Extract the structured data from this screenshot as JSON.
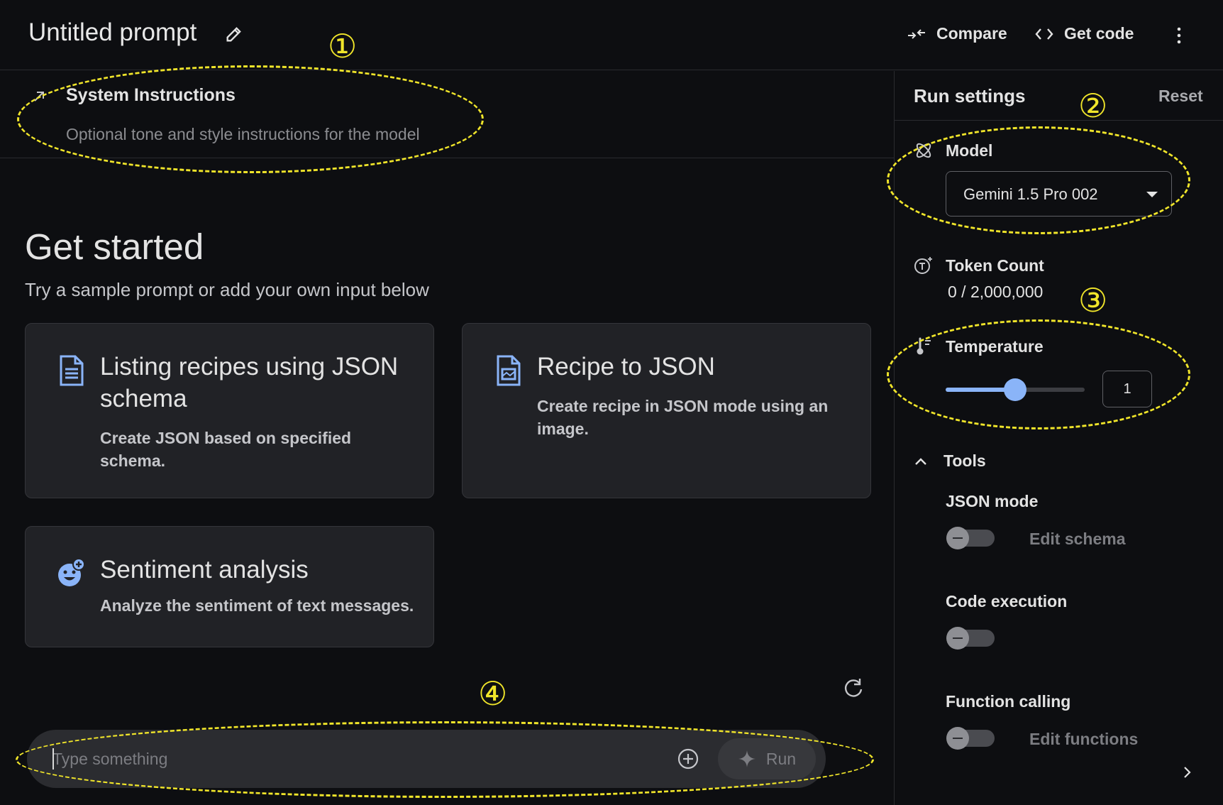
{
  "header": {
    "title": "Untitled prompt",
    "compare_label": "Compare",
    "get_code_label": "Get code"
  },
  "system_instructions": {
    "title": "System Instructions",
    "placeholder": "Optional tone and style instructions for the model"
  },
  "main": {
    "heading": "Get started",
    "subheading": "Try a sample prompt or add your own input below",
    "cards": [
      {
        "title_line1": "Listing recipes using JSON",
        "title_line2": "schema",
        "desc_line1": "Create JSON based on specified",
        "desc_line2": "schema.",
        "icon": "document-icon"
      },
      {
        "title_line1": "Recipe to JSON",
        "desc_line1": "Create recipe in JSON mode using an",
        "desc_line2": "image.",
        "icon": "document-image-icon"
      },
      {
        "title_line1": "Sentiment analysis",
        "desc_line1": "Analyze the sentiment of text messages.",
        "icon": "emoji-add-icon"
      }
    ]
  },
  "input": {
    "placeholder": "Type something",
    "run_label": "Run"
  },
  "run_settings": {
    "title": "Run settings",
    "reset_label": "Reset",
    "model_label": "Model",
    "model_value": "Gemini 1.5 Pro 002",
    "token_label": "Token Count",
    "token_value": "0 / 2,000,000",
    "temperature_label": "Temperature",
    "temperature_value": "1",
    "temperature_fraction": 0.5,
    "tools_label": "Tools",
    "tools": [
      {
        "label": "JSON mode",
        "link": "Edit schema",
        "enabled": false
      },
      {
        "label": "Code execution",
        "link": "",
        "enabled": false
      },
      {
        "label": "Function calling",
        "link": "Edit functions",
        "enabled": false
      }
    ]
  },
  "annotations": [
    "①",
    "②",
    "③",
    "④"
  ],
  "colors": {
    "background": "#0d0e11",
    "accent": "#8ab4f8",
    "annotation": "#f0e52a"
  }
}
